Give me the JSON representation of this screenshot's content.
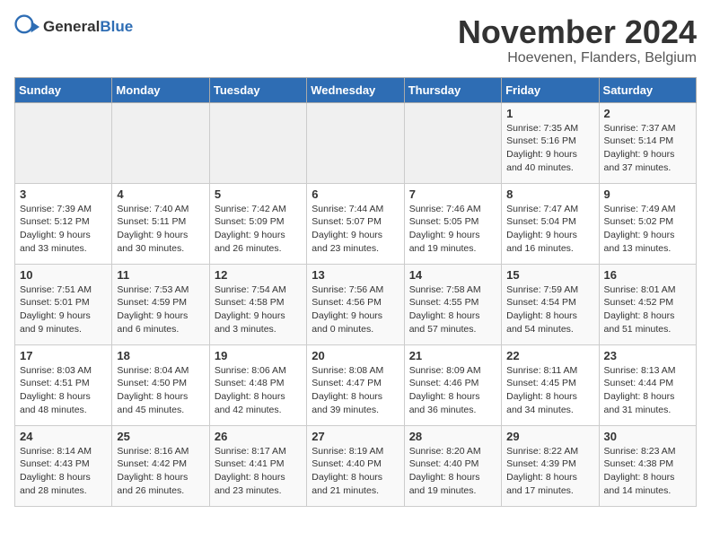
{
  "header": {
    "logo_general": "General",
    "logo_blue": "Blue",
    "month_title": "November 2024",
    "location": "Hoevenen, Flanders, Belgium"
  },
  "days_of_week": [
    "Sunday",
    "Monday",
    "Tuesday",
    "Wednesday",
    "Thursday",
    "Friday",
    "Saturday"
  ],
  "weeks": [
    [
      {
        "day": "",
        "info": ""
      },
      {
        "day": "",
        "info": ""
      },
      {
        "day": "",
        "info": ""
      },
      {
        "day": "",
        "info": ""
      },
      {
        "day": "",
        "info": ""
      },
      {
        "day": "1",
        "info": "Sunrise: 7:35 AM\nSunset: 5:16 PM\nDaylight: 9 hours and 40 minutes."
      },
      {
        "day": "2",
        "info": "Sunrise: 7:37 AM\nSunset: 5:14 PM\nDaylight: 9 hours and 37 minutes."
      }
    ],
    [
      {
        "day": "3",
        "info": "Sunrise: 7:39 AM\nSunset: 5:12 PM\nDaylight: 9 hours and 33 minutes."
      },
      {
        "day": "4",
        "info": "Sunrise: 7:40 AM\nSunset: 5:11 PM\nDaylight: 9 hours and 30 minutes."
      },
      {
        "day": "5",
        "info": "Sunrise: 7:42 AM\nSunset: 5:09 PM\nDaylight: 9 hours and 26 minutes."
      },
      {
        "day": "6",
        "info": "Sunrise: 7:44 AM\nSunset: 5:07 PM\nDaylight: 9 hours and 23 minutes."
      },
      {
        "day": "7",
        "info": "Sunrise: 7:46 AM\nSunset: 5:05 PM\nDaylight: 9 hours and 19 minutes."
      },
      {
        "day": "8",
        "info": "Sunrise: 7:47 AM\nSunset: 5:04 PM\nDaylight: 9 hours and 16 minutes."
      },
      {
        "day": "9",
        "info": "Sunrise: 7:49 AM\nSunset: 5:02 PM\nDaylight: 9 hours and 13 minutes."
      }
    ],
    [
      {
        "day": "10",
        "info": "Sunrise: 7:51 AM\nSunset: 5:01 PM\nDaylight: 9 hours and 9 minutes."
      },
      {
        "day": "11",
        "info": "Sunrise: 7:53 AM\nSunset: 4:59 PM\nDaylight: 9 hours and 6 minutes."
      },
      {
        "day": "12",
        "info": "Sunrise: 7:54 AM\nSunset: 4:58 PM\nDaylight: 9 hours and 3 minutes."
      },
      {
        "day": "13",
        "info": "Sunrise: 7:56 AM\nSunset: 4:56 PM\nDaylight: 9 hours and 0 minutes."
      },
      {
        "day": "14",
        "info": "Sunrise: 7:58 AM\nSunset: 4:55 PM\nDaylight: 8 hours and 57 minutes."
      },
      {
        "day": "15",
        "info": "Sunrise: 7:59 AM\nSunset: 4:54 PM\nDaylight: 8 hours and 54 minutes."
      },
      {
        "day": "16",
        "info": "Sunrise: 8:01 AM\nSunset: 4:52 PM\nDaylight: 8 hours and 51 minutes."
      }
    ],
    [
      {
        "day": "17",
        "info": "Sunrise: 8:03 AM\nSunset: 4:51 PM\nDaylight: 8 hours and 48 minutes."
      },
      {
        "day": "18",
        "info": "Sunrise: 8:04 AM\nSunset: 4:50 PM\nDaylight: 8 hours and 45 minutes."
      },
      {
        "day": "19",
        "info": "Sunrise: 8:06 AM\nSunset: 4:48 PM\nDaylight: 8 hours and 42 minutes."
      },
      {
        "day": "20",
        "info": "Sunrise: 8:08 AM\nSunset: 4:47 PM\nDaylight: 8 hours and 39 minutes."
      },
      {
        "day": "21",
        "info": "Sunrise: 8:09 AM\nSunset: 4:46 PM\nDaylight: 8 hours and 36 minutes."
      },
      {
        "day": "22",
        "info": "Sunrise: 8:11 AM\nSunset: 4:45 PM\nDaylight: 8 hours and 34 minutes."
      },
      {
        "day": "23",
        "info": "Sunrise: 8:13 AM\nSunset: 4:44 PM\nDaylight: 8 hours and 31 minutes."
      }
    ],
    [
      {
        "day": "24",
        "info": "Sunrise: 8:14 AM\nSunset: 4:43 PM\nDaylight: 8 hours and 28 minutes."
      },
      {
        "day": "25",
        "info": "Sunrise: 8:16 AM\nSunset: 4:42 PM\nDaylight: 8 hours and 26 minutes."
      },
      {
        "day": "26",
        "info": "Sunrise: 8:17 AM\nSunset: 4:41 PM\nDaylight: 8 hours and 23 minutes."
      },
      {
        "day": "27",
        "info": "Sunrise: 8:19 AM\nSunset: 4:40 PM\nDaylight: 8 hours and 21 minutes."
      },
      {
        "day": "28",
        "info": "Sunrise: 8:20 AM\nSunset: 4:40 PM\nDaylight: 8 hours and 19 minutes."
      },
      {
        "day": "29",
        "info": "Sunrise: 8:22 AM\nSunset: 4:39 PM\nDaylight: 8 hours and 17 minutes."
      },
      {
        "day": "30",
        "info": "Sunrise: 8:23 AM\nSunset: 4:38 PM\nDaylight: 8 hours and 14 minutes."
      }
    ]
  ]
}
